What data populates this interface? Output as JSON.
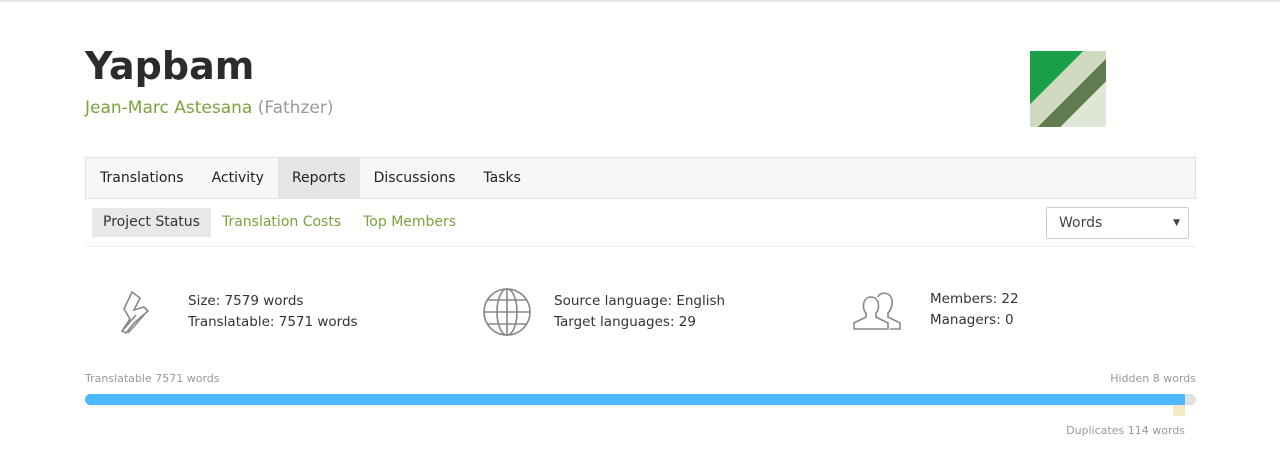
{
  "project": {
    "title": "Yapbam",
    "owner_name": "Jean-Marc Astesana",
    "owner_user": "(Fathzer)"
  },
  "tabs": [
    "Translations",
    "Activity",
    "Reports",
    "Discussions",
    "Tasks"
  ],
  "subtabs": [
    "Project Status",
    "Translation Costs",
    "Top Members"
  ],
  "unit_select": {
    "value": "Words"
  },
  "stats": {
    "size": "Size: 7579 words",
    "translatable": "Translatable: 7571 words",
    "source": "Source language: English",
    "targets": "Target languages: 29",
    "members": "Members: 22",
    "managers": "Managers: 0"
  },
  "progress": {
    "left_label": "Translatable 7571 words",
    "right_label": "Hidden 8 words",
    "dup_label": "Duplicates 114 words",
    "translatable_fraction": 0.9905,
    "color": "#4bb8ff"
  }
}
